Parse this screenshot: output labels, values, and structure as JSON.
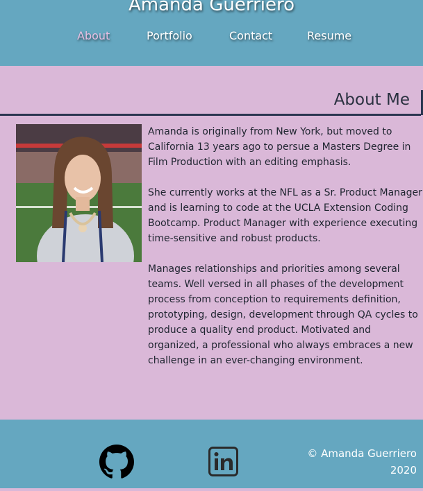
{
  "header": {
    "title": "Amanda Guerriero",
    "nav": [
      "About",
      "Portfolio",
      "Contact",
      "Resume"
    ],
    "active_nav": "About"
  },
  "about": {
    "heading": "About Me",
    "photo_alt": "Amanda Guerriero",
    "paragraphs": [
      "Amanda is originally from New York, but moved to California 13 years ago to persue a Masters Degree in Film Production with an editing emphasis.",
      "She currently works at the NFL as a Sr. Product Manager and is learning to code at the UCLA Extension Coding Bootcamp. Product Manager with experience executing time-sensitive and robust products.",
      "Manages relationships and priorities among several teams. Well versed in all phases of the development process from conception to requirements definition, prototyping, design, development through QA cycles to produce a quality end product. Motivated and organized, a professional who always embraces a new challenge in an ever-changing environment."
    ]
  },
  "footer": {
    "icons": [
      "github-icon",
      "linkedin-icon"
    ],
    "copyright_line1": "© Amanda Guerriero",
    "copyright_line2": "2020"
  },
  "colors": {
    "header_bg": "#65a7c0",
    "page_bg": "#dab8d8",
    "heading_text": "#2a3140",
    "active_nav": "#e6bfe2"
  }
}
